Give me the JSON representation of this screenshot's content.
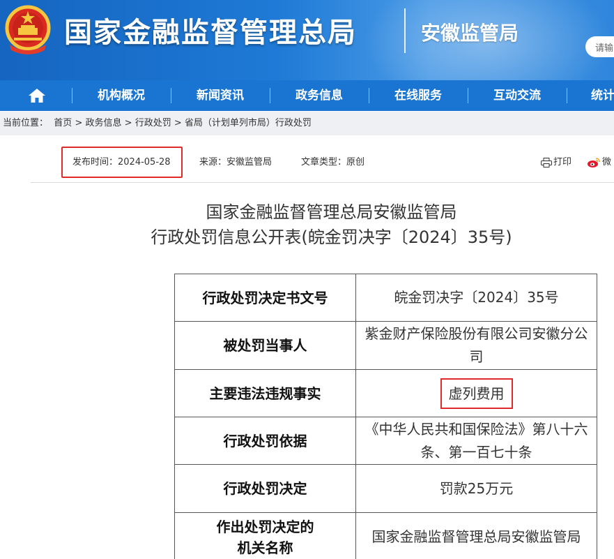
{
  "header": {
    "title": "国家金融监督管理总局",
    "subtitle": "安徽监管局",
    "search_placeholder": "请输"
  },
  "nav": {
    "items": [
      "机构概况",
      "新闻资讯",
      "政务信息",
      "在线服务",
      "互动交流",
      "统计"
    ]
  },
  "breadcrumb": {
    "label": "当前位置：",
    "items": [
      "首页",
      "政务信息",
      "行政处罚",
      "省局（计划单列市局）行政处罚"
    ],
    "separator": ">"
  },
  "meta": {
    "date_label": "发布时间：",
    "date_value": "2024-05-28",
    "source_label": "来源：",
    "source_value": "安徽监管局",
    "type_label": "文章类型：",
    "type_value": "原创",
    "print_label": "打印",
    "weibo_label": "微"
  },
  "article": {
    "title_line1": "国家金融监督管理总局安徽监管局",
    "title_line2": "行政处罚信息公开表(皖金罚决字〔2024〕35号)"
  },
  "table": {
    "rows": [
      {
        "key": "行政处罚决定书文号",
        "value": "皖金罚决字〔2024〕35号"
      },
      {
        "key": "被处罚当事人",
        "value": "紫金财产保险股份有限公司安徽分公司"
      },
      {
        "key": "主要违法违规事实",
        "value": "虚列费用"
      },
      {
        "key": "行政处罚依据",
        "value": "《中华人民共和国保险法》第八十六条、第一百七十条"
      },
      {
        "key": "行政处罚决定",
        "value": "罚款25万元"
      },
      {
        "key_line1": "作出处罚决定的",
        "key_line2": "机关名称",
        "value": "国家金融监督管理总局安徽监管局"
      }
    ]
  },
  "colors": {
    "brand_blue": "#1a75d2",
    "highlight_red": "#e02a2a"
  },
  "icons": [
    "national-emblem-icon",
    "home-icon",
    "print-icon",
    "weibo-icon"
  ]
}
